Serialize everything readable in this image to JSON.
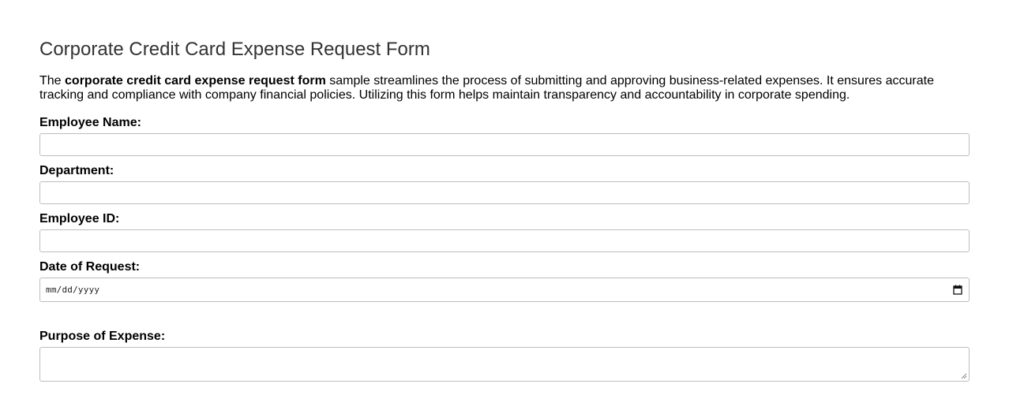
{
  "form": {
    "title": "Corporate Credit Card Expense Request Form",
    "intro": {
      "prefix": "The ",
      "bold": "corporate credit card expense request form",
      "suffix": " sample streamlines the process of submitting and approving business-related expenses. It ensures accurate tracking and compliance with company financial policies. Utilizing this form helps maintain transparency and accountability in corporate spending."
    },
    "fields": {
      "employee_name": {
        "label": "Employee Name:",
        "value": ""
      },
      "department": {
        "label": "Department:",
        "value": ""
      },
      "employee_id": {
        "label": "Employee ID:",
        "value": ""
      },
      "date_of_request": {
        "label": "Date of Request:",
        "placeholder": "mm/dd/yyyy",
        "icon": "calendar-icon"
      },
      "purpose_of_expense": {
        "label": "Purpose of Expense:",
        "value": ""
      }
    }
  }
}
